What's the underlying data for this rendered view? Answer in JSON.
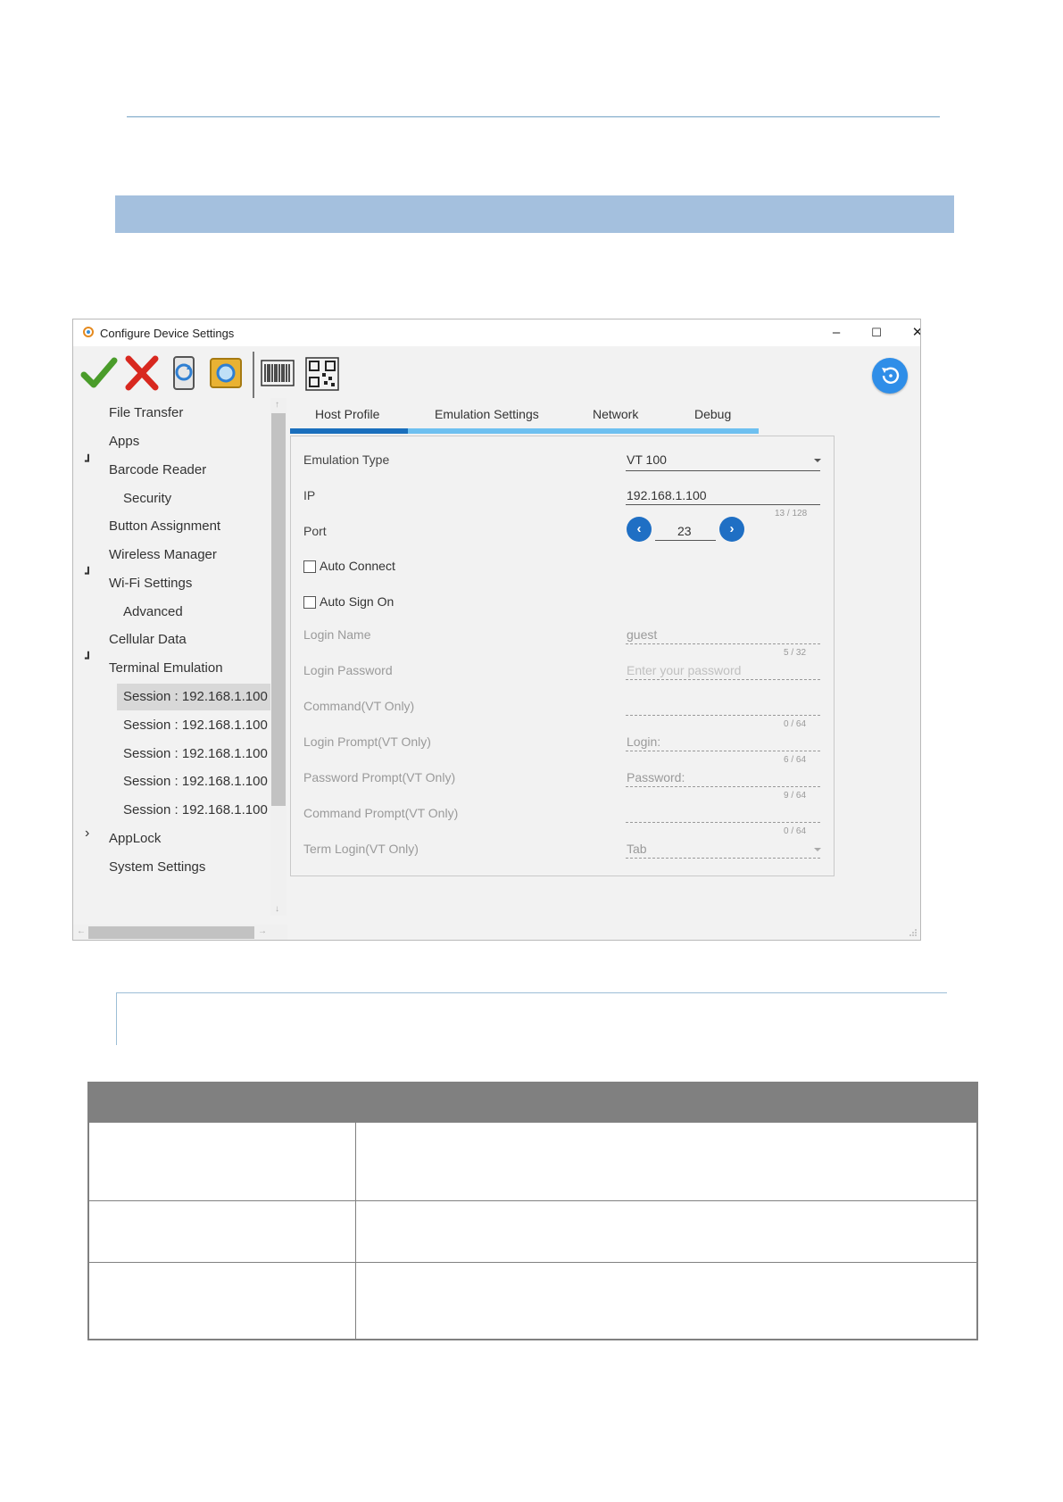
{
  "window": {
    "title": "Configure Device Settings",
    "minimize": "–",
    "maximize": "☐",
    "close": "✕"
  },
  "toolbar": {
    "icons": [
      "apply-check-icon",
      "cancel-x-icon",
      "device-sync-icon",
      "restore-icon",
      "barcode-icon",
      "qr-code-icon"
    ],
    "reset_icon": "reset-icon"
  },
  "tree": {
    "items": [
      {
        "label": "File Transfer"
      },
      {
        "label": "Apps"
      },
      {
        "label": "Barcode Reader",
        "caret": "┛"
      },
      {
        "label": "Security"
      },
      {
        "label": "Button Assignment"
      },
      {
        "label": "Wireless Manager"
      },
      {
        "label": "Wi-Fi Settings",
        "caret": "┛"
      },
      {
        "label": "Advanced"
      },
      {
        "label": "Cellular Data"
      },
      {
        "label": "Terminal Emulation",
        "caret": "┛"
      },
      {
        "label": "Session : 192.168.1.100"
      },
      {
        "label": "Session : 192.168.1.100"
      },
      {
        "label": "Session : 192.168.1.100"
      },
      {
        "label": "Session : 192.168.1.100"
      },
      {
        "label": "Session : 192.168.1.100"
      },
      {
        "label": "AppLock",
        "caret": "›"
      },
      {
        "label": "System Settings"
      }
    ]
  },
  "tabs": [
    {
      "label": "Host Profile"
    },
    {
      "label": "Emulation Settings"
    },
    {
      "label": "Network"
    },
    {
      "label": "Debug"
    }
  ],
  "form": {
    "emulation_type": {
      "label": "Emulation Type",
      "value": "VT 100"
    },
    "ip": {
      "label": "IP",
      "value": "192.168.1.100",
      "counter": "13 / 128"
    },
    "port": {
      "label": "Port",
      "value": "23",
      "prev": "‹",
      "next": "›"
    },
    "auto_connect": {
      "label": "Auto Connect"
    },
    "auto_sign_on": {
      "label": "Auto Sign On"
    },
    "login_name": {
      "label": "Login Name",
      "value": "guest",
      "counter": "5 / 32"
    },
    "login_password": {
      "label": "Login Password",
      "placeholder": "Enter your password"
    },
    "command": {
      "label": "Command(VT Only)",
      "value": "",
      "counter": "0 / 64"
    },
    "login_prompt": {
      "label": "Login Prompt(VT Only)",
      "value": "Login:",
      "counter": "6 / 64"
    },
    "password_prompt": {
      "label": "Password Prompt(VT Only)",
      "value": "Password:",
      "counter": "9 / 64"
    },
    "command_prompt": {
      "label": "Command Prompt(VT Only)",
      "value": "",
      "counter": "0 / 64"
    },
    "term_login": {
      "label": "Term Login(VT Only)",
      "value": "Tab"
    }
  },
  "colors": {
    "section_bar": "#a4c0de",
    "accent_blue": "#1f6fc4",
    "tab_strip": "#6ec0f0",
    "table_header": "#808080"
  }
}
